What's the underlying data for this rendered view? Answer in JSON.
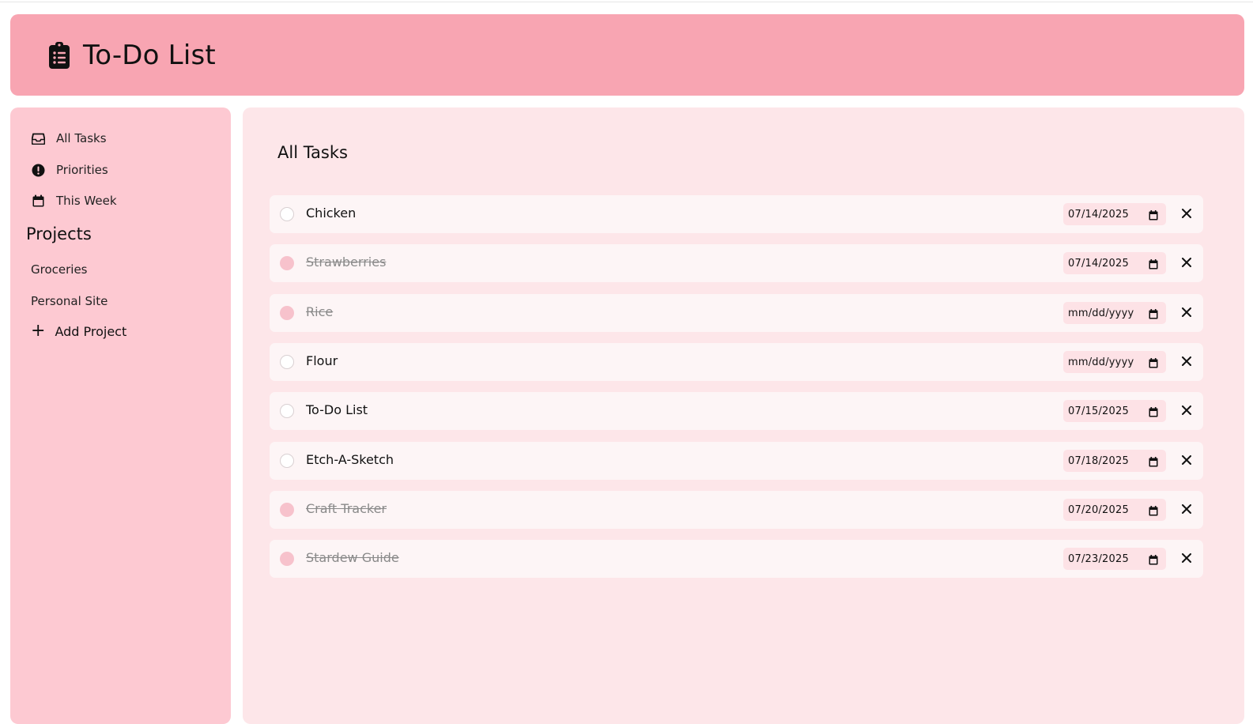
{
  "header": {
    "title": "To-Do List",
    "icon": "clipboard-list-icon"
  },
  "sidebar": {
    "nav": [
      {
        "label": "All Tasks",
        "icon": "inbox-icon"
      },
      {
        "label": "Priorities",
        "icon": "exclamation-circle-icon"
      },
      {
        "label": "This Week",
        "icon": "calendar-icon"
      }
    ],
    "projects_heading": "Projects",
    "projects": [
      "Groceries",
      "Personal Site"
    ],
    "add_project_label": "Add Project"
  },
  "main": {
    "title": "All Tasks",
    "tasks": [
      {
        "name": "Chicken",
        "done": false,
        "date": "07/14/2025"
      },
      {
        "name": "Strawberries",
        "done": true,
        "date": "07/14/2025"
      },
      {
        "name": "Rice",
        "done": true,
        "date": "mm/dd/yyyy"
      },
      {
        "name": "Flour",
        "done": false,
        "date": "mm/dd/yyyy"
      },
      {
        "name": "To-Do List",
        "done": false,
        "date": "07/15/2025"
      },
      {
        "name": "Etch-A-Sketch",
        "done": false,
        "date": "07/18/2025"
      },
      {
        "name": "Craft Tracker",
        "done": true,
        "date": "07/20/2025"
      },
      {
        "name": "Stardew Guide",
        "done": true,
        "date": "07/23/2025"
      }
    ]
  },
  "colors": {
    "header_bg": "#f8a5b2",
    "sidebar_bg": "#fdc9d2",
    "main_bg": "#fde6e9",
    "task_bg": "#fdf5f6",
    "done_check": "#f7c2cc"
  }
}
